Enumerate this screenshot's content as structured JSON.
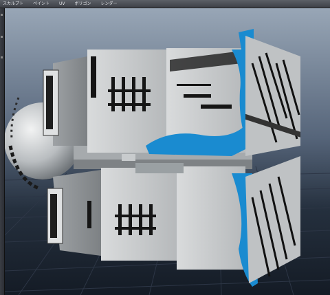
{
  "menubar": {
    "items": [
      "スカルプト",
      "ペイント",
      "UV",
      "ポリゴン",
      "レンダー"
    ]
  },
  "viewport": {
    "background_top": "#98a6b6",
    "background_bottom": "#17202c",
    "grid_color": "#2c3442",
    "model_color": "#c9ccce",
    "paint_accent": "#1a8bd0"
  }
}
